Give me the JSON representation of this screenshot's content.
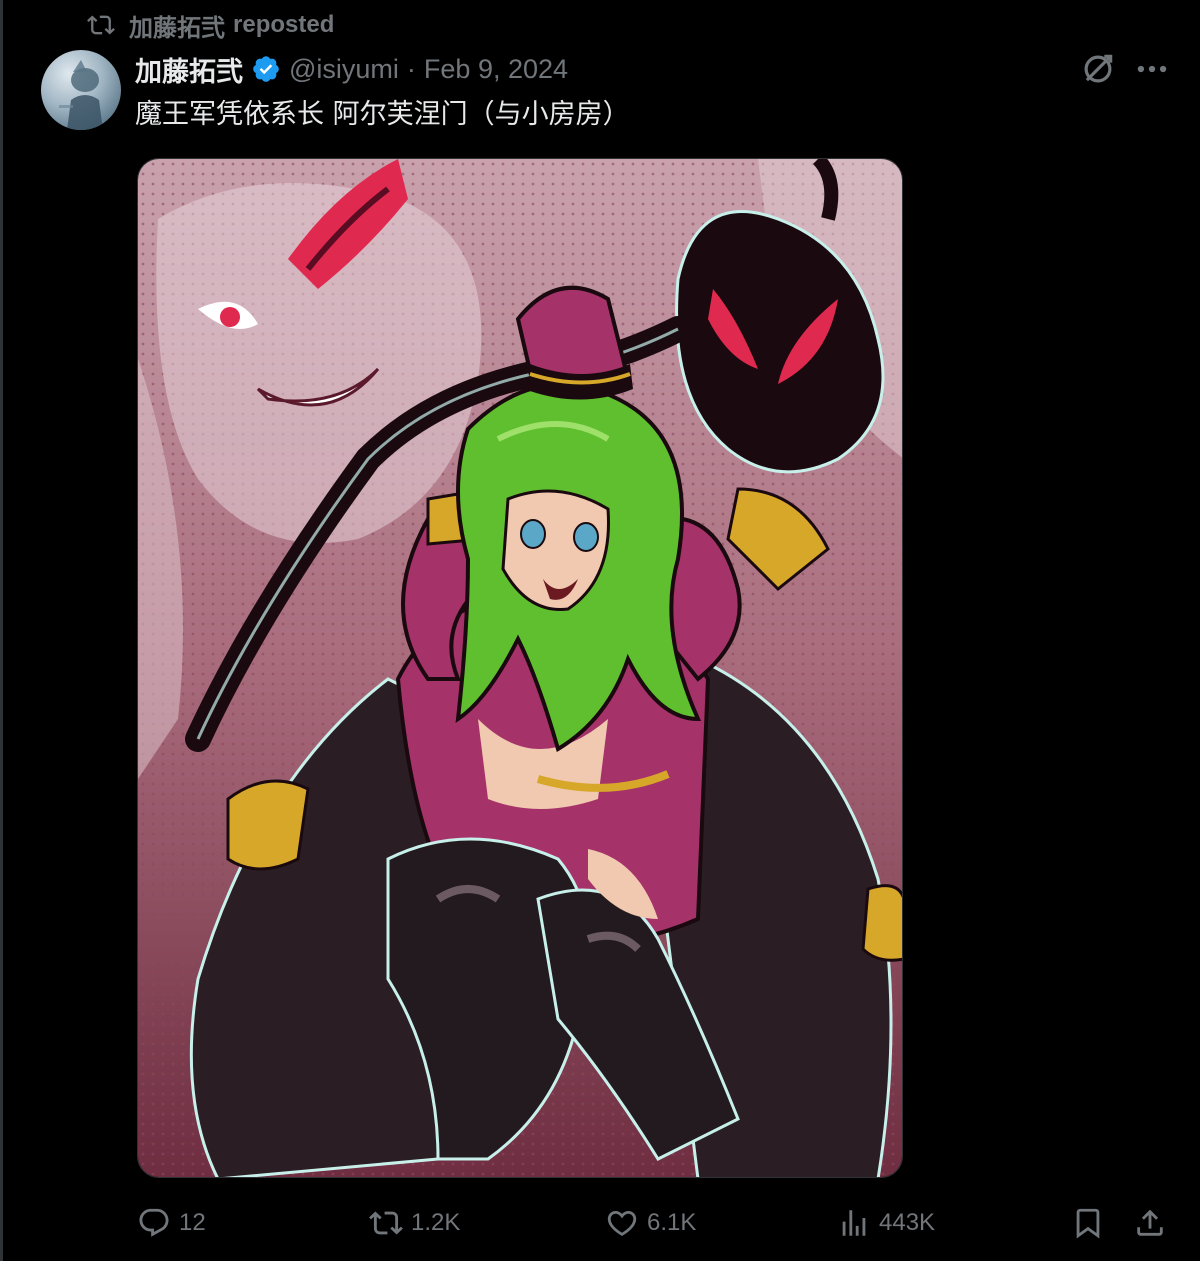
{
  "repost": {
    "reposter_name": "加藤拓弐",
    "label": "reposted"
  },
  "post": {
    "display_name": "加藤拓弐",
    "handle": "@isiyumi",
    "separator": "·",
    "date": "Feb 9, 2024",
    "text": "魔王军凭依系长 阿尔芙涅门（与小房房）",
    "verified": true
  },
  "icons": {
    "repost_header": "repost-icon",
    "verified": "verified-badge-icon",
    "grok": "grok-icon",
    "more": "more-icon",
    "reply": "reply-icon",
    "repost": "repost-icon",
    "like": "like-icon",
    "views": "views-icon",
    "bookmark": "bookmark-icon",
    "share": "share-icon"
  },
  "actions": {
    "replies": "12",
    "reposts": "1.2K",
    "likes": "6.1K",
    "views": "443K"
  },
  "colors": {
    "background": "#000000",
    "text_primary": "#e7e9ea",
    "text_secondary": "#71767b",
    "verified_blue": "#1d9bf0",
    "border": "#2f3336"
  }
}
